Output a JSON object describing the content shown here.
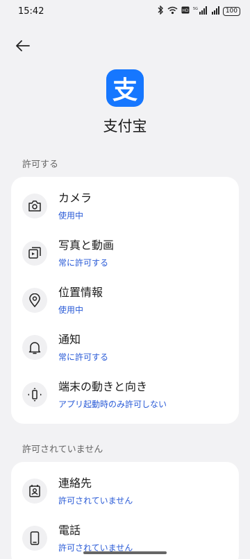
{
  "status": {
    "time": "15:42",
    "battery": "100"
  },
  "app": {
    "name": "支付宝",
    "icon_char": "支"
  },
  "sections": [
    {
      "label": "許可する",
      "items": [
        {
          "icon": "camera-icon",
          "title": "カメラ",
          "subtitle": "使用中"
        },
        {
          "icon": "photos-videos-icon",
          "title": "写真と動画",
          "subtitle": "常に許可する"
        },
        {
          "icon": "location-icon",
          "title": "位置情報",
          "subtitle": "使用中"
        },
        {
          "icon": "bell-icon",
          "title": "通知",
          "subtitle": "常に許可する"
        },
        {
          "icon": "device-motion-icon",
          "title": "端末の動きと向き",
          "subtitle": "アプリ起動時のみ許可しない"
        }
      ]
    },
    {
      "label": "許可されていません",
      "items": [
        {
          "icon": "contacts-icon",
          "title": "連絡先",
          "subtitle": "許可されていません"
        },
        {
          "icon": "phone-icon",
          "title": "電話",
          "subtitle": "許可されていません"
        }
      ]
    }
  ],
  "colors": {
    "accent": "#2a5bd7",
    "app_icon_bg": "#1677ff"
  }
}
